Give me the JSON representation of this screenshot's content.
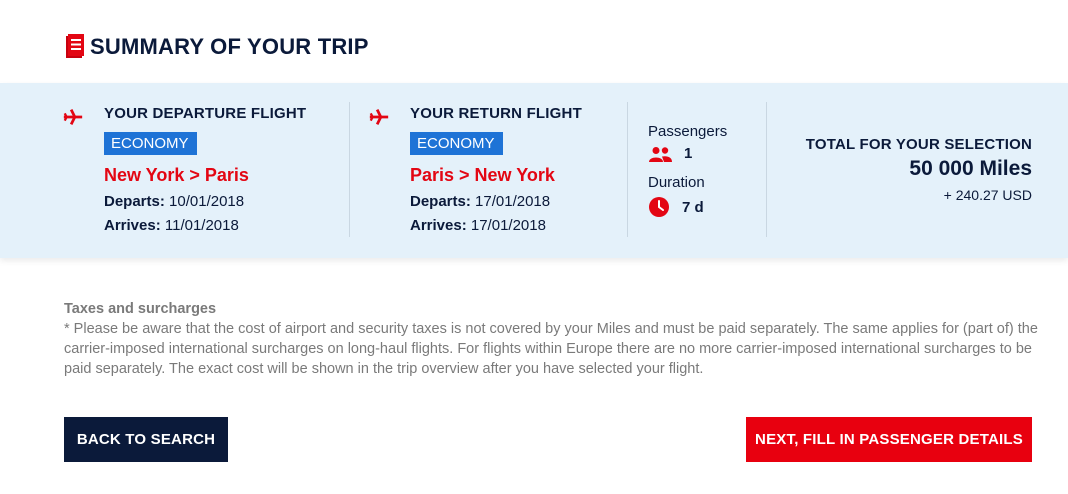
{
  "page": {
    "title": "SUMMARY OF YOUR TRIP",
    "title_icon": "document-icon"
  },
  "departure": {
    "icon": "plane-icon",
    "heading": "YOUR DEPARTURE FLIGHT",
    "cabin": "ECONOMY",
    "route": "New York > Paris",
    "departs_label": "Departs:",
    "departs_date": "10/01/2018",
    "arrives_label": "Arrives:",
    "arrives_date": "11/01/2018"
  },
  "return": {
    "icon": "plane-icon",
    "heading": "YOUR RETURN FLIGHT",
    "cabin": "ECONOMY",
    "route": "Paris > New York",
    "departs_label": "Departs:",
    "departs_date": "17/01/2018",
    "arrives_label": "Arrives:",
    "arrives_date": "17/01/2018"
  },
  "trip_info": {
    "passengers_label": "Passengers",
    "passengers_icon": "people-icon",
    "passengers_value": "1",
    "duration_label": "Duration",
    "duration_icon": "clock-icon",
    "duration_value": "7 d"
  },
  "total": {
    "label": "TOTAL FOR YOUR SELECTION",
    "miles": "50 000 Miles",
    "cash": "+ 240.27 USD"
  },
  "taxes": {
    "title": "Taxes and surcharges",
    "text": "* Please be aware that the cost of airport and security taxes is not covered by your Miles and must be paid separately. The same applies for (part of) the carrier-imposed international surcharges on long-haul flights. For flights within Europe there are no more carrier-imposed international surcharges to be paid separately. The exact cost will be shown in the trip overview after you have selected your flight."
  },
  "actions": {
    "back_label": "BACK TO SEARCH",
    "next_label": "NEXT, FILL IN PASSENGER DETAILS"
  },
  "colors": {
    "navy": "#0b1a3a",
    "red": "#e30613",
    "badge_blue": "#1e73d6",
    "band_bg": "#e4f1fa"
  }
}
